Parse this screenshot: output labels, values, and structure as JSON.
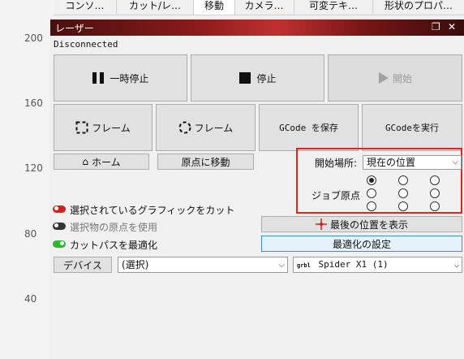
{
  "ruler": {
    "ticks": [
      "200",
      "160",
      "120",
      "80",
      "40"
    ]
  },
  "tabs": [
    {
      "label": "コンソ…",
      "active": false
    },
    {
      "label": "カット/レ…",
      "active": false
    },
    {
      "label": "移動",
      "active": true
    },
    {
      "label": "カメラ…",
      "active": false
    },
    {
      "label": "可変テキ…",
      "active": false
    },
    {
      "label": "形状のプロパ…",
      "active": false
    }
  ],
  "panel": {
    "title": "レーザー",
    "float_icon": "restore-icon",
    "close_icon": "close-icon"
  },
  "status": "Disconnected",
  "controls": {
    "pause": "一時停止",
    "stop": "停止",
    "start": "開始",
    "frame1": "フレーム",
    "frame2": "フレーム",
    "save_gcode": "GCode を保存",
    "run_gcode": "GCodeを実行",
    "home": "ホーム",
    "goto_origin": "原点に移動"
  },
  "start_from": {
    "label": "開始場所:",
    "value": "現在の位置"
  },
  "job_origin": {
    "label": "ジョブ原点",
    "selected_index": 0
  },
  "options": {
    "cut_selected": "選択されているグラフィックをカット",
    "use_origin": "選択物の原点を使用",
    "optimize": "カットパスを最適化"
  },
  "show_last_position": "最後の位置を表示",
  "optimize_settings": "最適化の設定",
  "device_label": "デバイス",
  "device_select": "(選択)",
  "machine_select": {
    "prefix": "grbl",
    "value": "Spider X1 (1)"
  },
  "colors": {
    "highlight": "#e8211b",
    "title_gradient_mid": "#c03030"
  }
}
